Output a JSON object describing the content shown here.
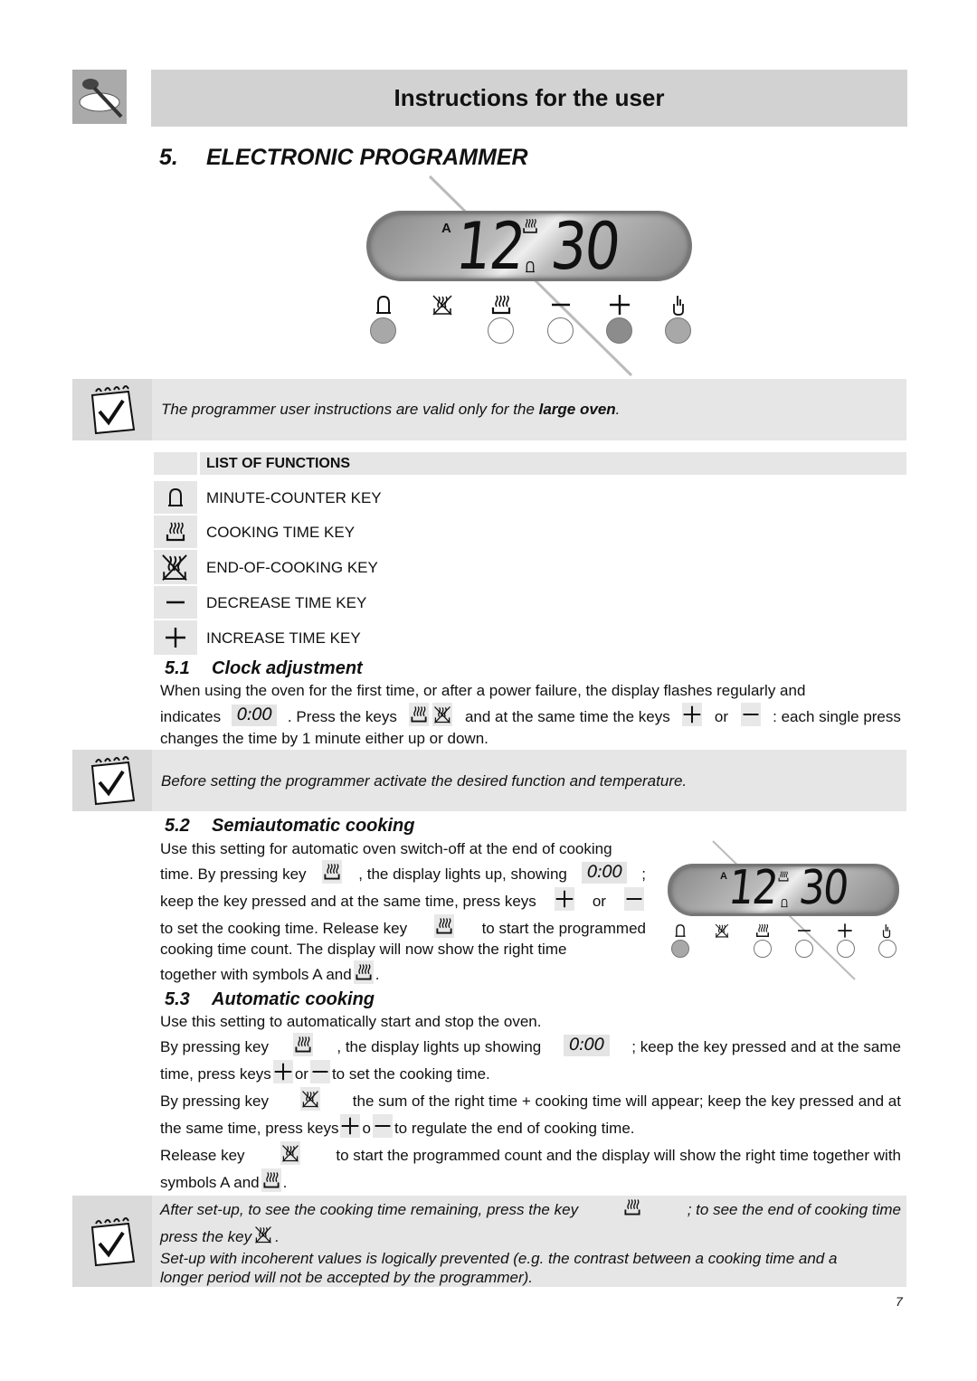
{
  "header": {
    "title": "Instructions for the user",
    "logo_icon": "chef-spoon-logo"
  },
  "section": {
    "number": "5.",
    "title": "ELECTRONIC PROGRAMMER"
  },
  "display": {
    "mode": "A",
    "hours": "12",
    "minutes": "30",
    "keys": [
      "bell-icon",
      "end-of-cooking-icon",
      "cooking-time-icon",
      "minus-icon",
      "plus-icon",
      "manual-hand-icon"
    ]
  },
  "note1": {
    "text_pre": "The programmer user instructions are valid only for the ",
    "text_bold": "large oven",
    "text_post": "."
  },
  "functions": {
    "header": "LIST OF FUNCTIONS",
    "items": [
      {
        "icon": "bell-icon",
        "label": "MINUTE-COUNTER KEY"
      },
      {
        "icon": "cooking-time-icon",
        "label": "COOKING TIME KEY"
      },
      {
        "icon": "end-of-cooking-icon",
        "label": "END-OF-COOKING KEY"
      },
      {
        "icon": "minus-icon",
        "label": "DECREASE TIME KEY"
      },
      {
        "icon": "plus-icon",
        "label": "INCREASE TIME KEY"
      }
    ]
  },
  "s51": {
    "number": "5.1",
    "title": "Clock adjustment",
    "l1": "When using the oven for the first time, or after a power failure, the display flashes regularly and",
    "l2a": "indicates",
    "zero": "0:00",
    "l2b": ". Press the keys",
    "l2c": "and at the same time the keys",
    "l2d": "or",
    "l2e": ": each single press",
    "l3": "changes the time by 1 minute either up or down."
  },
  "note2": {
    "text": "Before setting the programmer activate the desired function and temperature."
  },
  "s52": {
    "number": "5.2",
    "title": "Semiautomatic cooking",
    "l1": "Use this setting for automatic oven switch-off at the end of cooking",
    "l2a": "time. By pressing key",
    "l2b": ", the display lights up, showing",
    "l2c": ";",
    "l3a": "keep the key pressed and at the same time, press keys",
    "l3b": "or",
    "l4a": "to set the cooking time. Release key",
    "l4b": "to start the programmed",
    "l5": "cooking time count. The display will now show the right time",
    "l6a": "together with symbols A and",
    "l6b": "."
  },
  "s53": {
    "number": "5.3",
    "title": "Automatic cooking",
    "l1": "Use this setting to automatically start and stop the oven.",
    "l2a": "By pressing key",
    "l2b": ", the display lights up showing",
    "l2c": "; keep the key pressed and at the same",
    "l3a": "time, press keys",
    "l3b": "or",
    "l3c": "to set the cooking time.",
    "l4a": "By pressing key",
    "l4b": "the sum of the right time + cooking time will appear; keep the key pressed and at",
    "l5a": "the same time, press keys",
    "l5b": "o",
    "l5c": "to regulate the end of cooking time.",
    "l6a": "Release key",
    "l6b": "to start the programmed count and the display will show the right time together with",
    "l7a": "symbols A and",
    "l7b": "."
  },
  "note3": {
    "l1a": "After set-up, to see the cooking time remaining, press the key",
    "l1b": "; to see the end of cooking time",
    "l2a": "press the key",
    "l2b": ".",
    "l3": "Set-up with incoherent values is logically prevented (e.g. the contrast between a cooking time and a",
    "l4": "longer period will not be accepted by the programmer)."
  },
  "page_number": "7",
  "colors": {
    "header_band": "#d2d2d2",
    "note_bg": "#e6e6e6",
    "key_gray": "#a8a8a8",
    "key_dark": "#8c8c8c"
  }
}
